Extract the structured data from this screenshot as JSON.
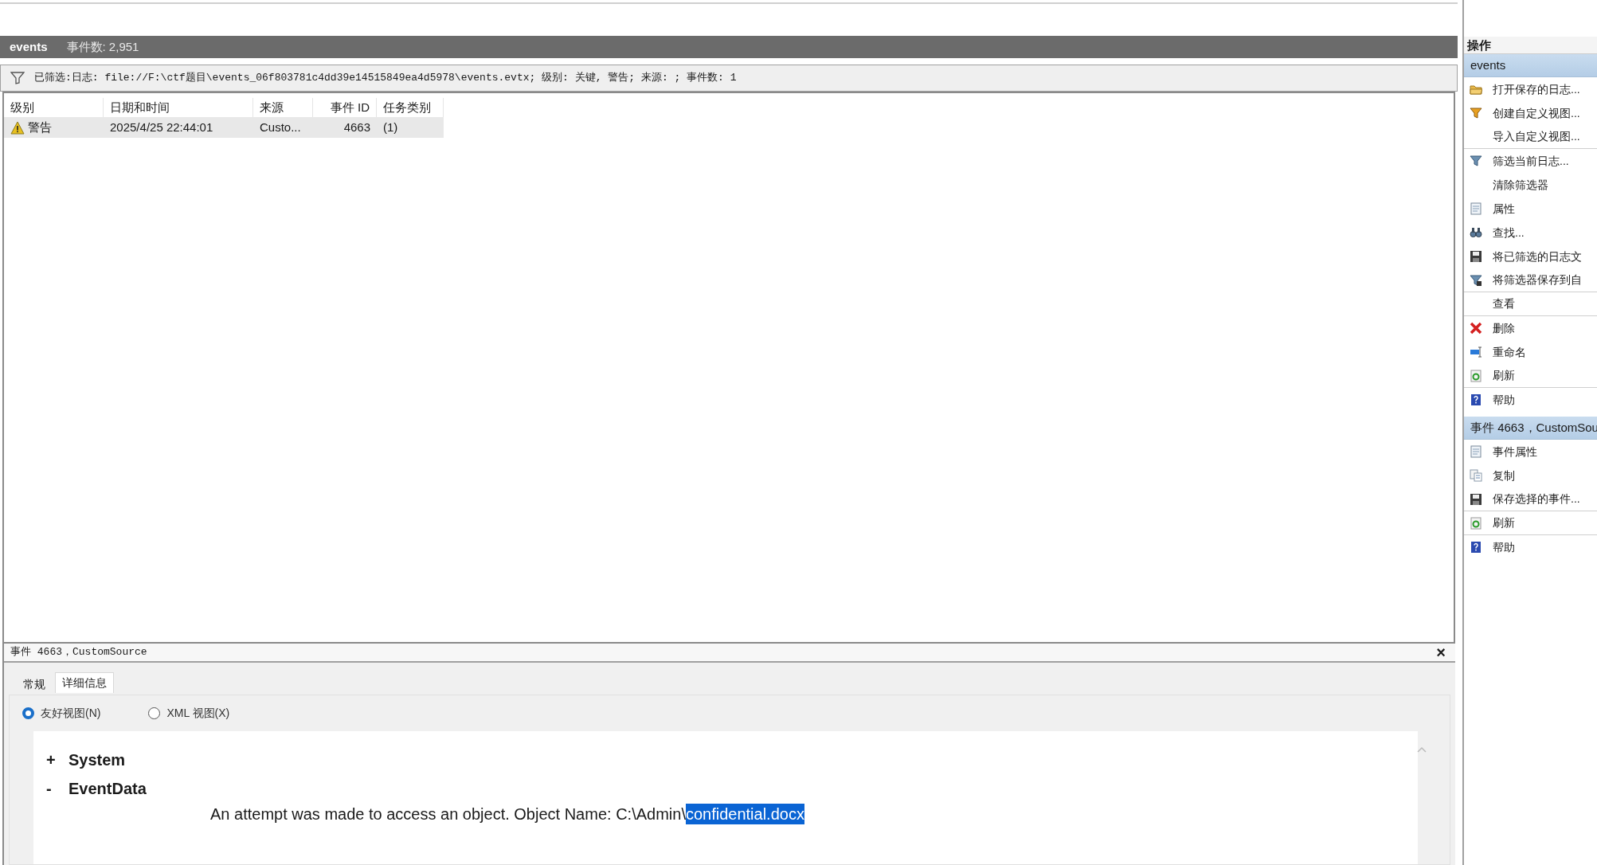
{
  "log_header": {
    "name": "events",
    "count": "事件数: 2,951"
  },
  "filter": {
    "text": "已筛选:日志: file://F:\\ctf题目\\events_06f803781c4dd39e14515849ea4d5978\\events.evtx; 级别: 关键, 警告; 来源: ; 事件数: 1"
  },
  "table": {
    "columns": [
      "级别",
      "日期和时间",
      "来源",
      "事件 ID",
      "任务类别"
    ],
    "rows": [
      {
        "selected": true,
        "kind": "warning",
        "cells": [
          "警告",
          "2025/4/25 22:44:01",
          "Custo...",
          "4663",
          "(1)"
        ]
      }
    ]
  },
  "details": {
    "title": "事件 4663，CustomSource",
    "close": "×",
    "tabs": [
      {
        "label": "常规",
        "selected": false
      },
      {
        "label": "详细信息",
        "selected": true
      }
    ],
    "views": [
      {
        "label": "友好视图(N)",
        "selected": true
      },
      {
        "label": "XML 视图(X)",
        "selected": false
      }
    ],
    "tree": [
      {
        "label": "System",
        "sign": "+"
      },
      {
        "label": "EventData",
        "sign": "-",
        "lines": [
          {
            "text": "An attempt was made to access an object. Object Name: C:\\Admin\\",
            "selection": "confidential.docx"
          }
        ]
      }
    ]
  },
  "actions": {
    "title": "操作",
    "sections": [
      {
        "title": "events",
        "items": [
          {
            "label": "打开保存的日志...",
            "kind": "folder",
            "separator_after": false
          },
          {
            "label": "创建自定义视图...",
            "kind": "funnel-gold",
            "separator_after": false
          },
          {
            "label": "导入自定义视图...",
            "kind": "plain",
            "separator_after": true
          },
          {
            "label": "筛选当前日志...",
            "kind": "funnel",
            "separator_after": false
          },
          {
            "label": "清除筛选器",
            "kind": "plain",
            "separator_after": false
          },
          {
            "label": "属性",
            "kind": "document",
            "separator_after": false
          },
          {
            "label": "查找...",
            "kind": "binoculars",
            "separator_after": false
          },
          {
            "label": "将已筛选的日志文",
            "kind": "floppy",
            "separator_after": false
          },
          {
            "label": "将筛选器保存到自",
            "kind": "funnel-save",
            "separator_after": true
          },
          {
            "label": "查看",
            "kind": "plain",
            "separator_after": true
          },
          {
            "label": "删除",
            "kind": "delete",
            "separator_after": false
          },
          {
            "label": "重命名",
            "kind": "rename",
            "separator_after": false
          },
          {
            "label": "刷新",
            "kind": "refresh",
            "separator_after": true
          },
          {
            "label": "帮助",
            "kind": "help",
            "separator_after": false
          }
        ]
      },
      {
        "title": "事件 4663，CustomSou",
        "items": [
          {
            "label": "事件属性",
            "kind": "document",
            "separator_after": false
          },
          {
            "label": "复制",
            "kind": "copy",
            "separator_after": false
          },
          {
            "label": "保存选择的事件...",
            "kind": "floppy",
            "separator_after": true
          },
          {
            "label": "刷新",
            "kind": "refresh",
            "separator_after": true
          },
          {
            "label": "帮助",
            "kind": "help",
            "separator_after": false
          }
        ]
      }
    ]
  }
}
